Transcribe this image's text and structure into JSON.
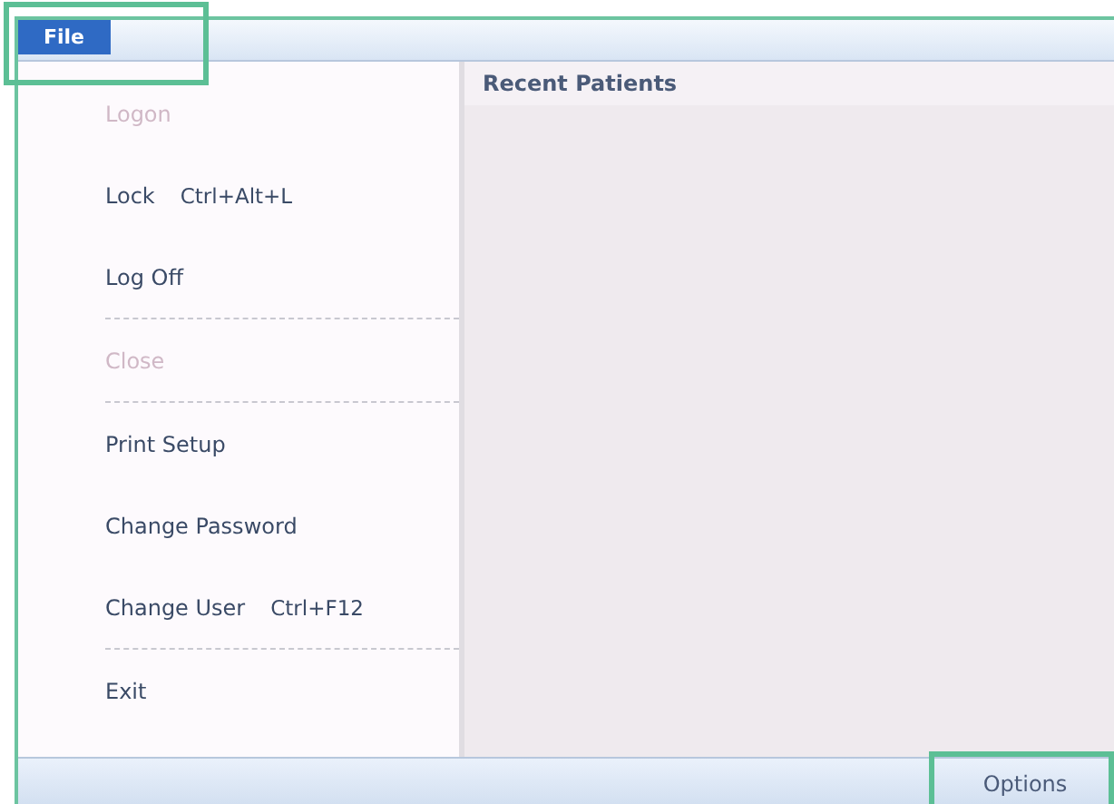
{
  "menu_bar": {
    "menus": [
      {
        "label": "File",
        "selected": true,
        "highlighted": true
      }
    ]
  },
  "file_menu": {
    "items": [
      {
        "kind": "item",
        "label": "Logon",
        "disabled": true
      },
      {
        "kind": "item",
        "label": "Lock",
        "shortcut": "Ctrl+Alt+L",
        "disabled": false
      },
      {
        "kind": "item",
        "label": "Log Off",
        "disabled": false
      },
      {
        "kind": "separator"
      },
      {
        "kind": "item",
        "label": "Close",
        "disabled": true
      },
      {
        "kind": "separator"
      },
      {
        "kind": "item",
        "label": "Print Setup",
        "disabled": false
      },
      {
        "kind": "item",
        "label": "Change Password",
        "disabled": false
      },
      {
        "kind": "item",
        "label": "Change User",
        "shortcut": "Ctrl+F12",
        "disabled": false
      },
      {
        "kind": "separator"
      },
      {
        "kind": "item",
        "label": "Exit",
        "disabled": false
      }
    ]
  },
  "recent_patients": {
    "title": "Recent Patients"
  },
  "status_bar": {
    "button": {
      "label": "Options",
      "highlighted": true
    }
  }
}
